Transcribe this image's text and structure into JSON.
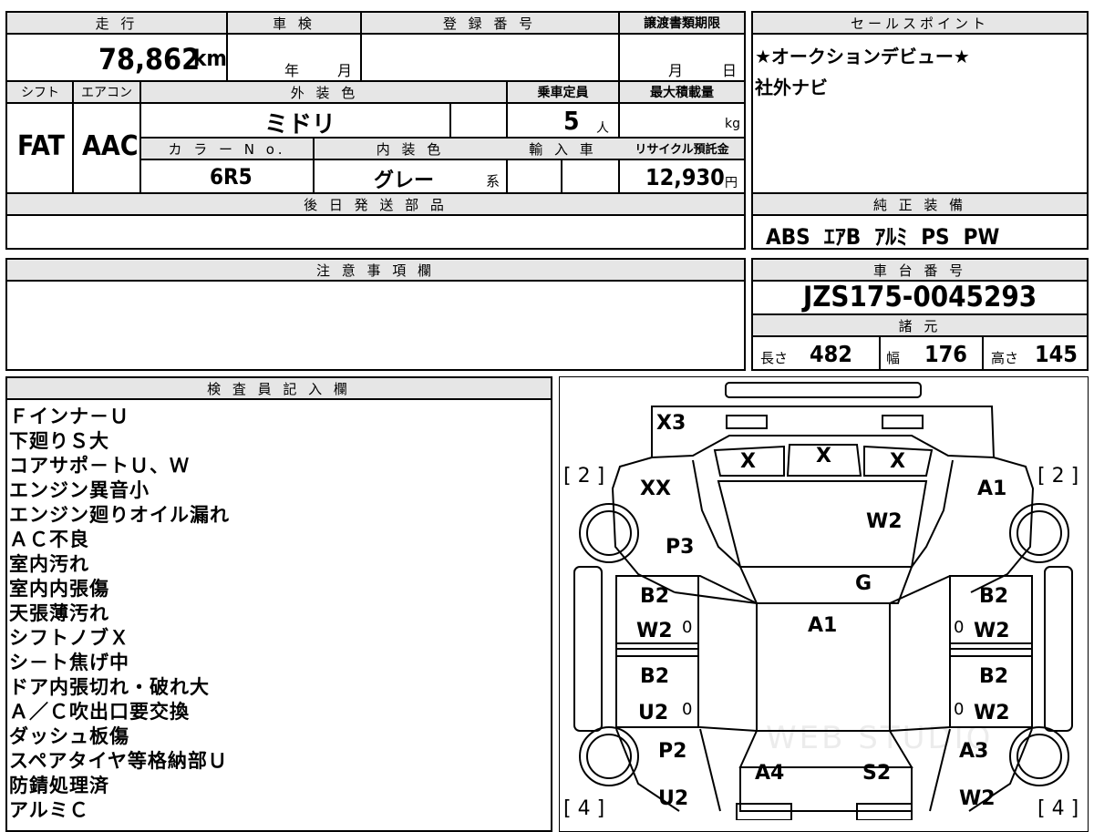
{
  "sheet": {
    "mileage_label": "走 行",
    "mileage_value": "78,862",
    "mileage_unit": "km",
    "inspection_label": "車 検",
    "inspection_year": "年",
    "inspection_month": "月",
    "registration_label": "登 録 番 号",
    "transfer_label": "譲渡書類期限",
    "transfer_month": "月",
    "transfer_day": "日",
    "shift_label": "シフト",
    "shift_value": "FAT",
    "aircon_label": "エアコン",
    "aircon_value": "AAC",
    "exterior_color_label": "外 装 色",
    "exterior_color_value": "ミドリ",
    "capacity_label": "乗車定員",
    "capacity_value": "5",
    "capacity_unit": "人",
    "max_load_label": "最大積載量",
    "max_load_unit": "kg",
    "color_no_label": "カ ラ ー N o.",
    "color_no_value": "6R5",
    "interior_color_label": "内 装 色",
    "interior_color_value": "グレー",
    "interior_color_suffix": "系",
    "import_label": "輸 入 車",
    "recycle_label": "リサイクル預託金",
    "recycle_value": "12,930",
    "recycle_unit": "円",
    "later_parts_label": "後 日 発 送 部 品",
    "notes_label": "注 意 事 項 欄",
    "sales_point_label": "セールスポイント",
    "sales_points": [
      "★オークションデビュー★",
      "社外ナビ"
    ],
    "equipment_label": "純 正 装 備",
    "equipment_value": "ABS  ｴｱB  ｱﾙﾐ  PS  PW",
    "chassis_label": "車 台 番 号",
    "chassis_value": "JZS175-0045293",
    "spec_label": "諸 元",
    "length_label": "長さ",
    "length_value": "482",
    "width_label": "幅",
    "width_value": "176",
    "height_label": "高さ",
    "height_value": "145",
    "inspector_label": "検 査 員 記 入 欄",
    "inspector_remarks": [
      "Ｆインナ－Ｕ",
      "下廻りＳ大",
      "コアサポ－トＵ、Ｗ",
      "エンジン異音小",
      "エンジン廻りオイル漏れ",
      "ＡＣ不良",
      "室内汚れ",
      "室内内張傷",
      "天張薄汚れ",
      "シフトノブＸ",
      "シ－ト焦げ中",
      "ドア内張切れ・破れ大",
      "Ａ／Ｃ吹出口要交換",
      "ダッシュ板傷",
      "スペアタイヤ等格納部Ｕ",
      "防錆処理済",
      "アルミＣ"
    ]
  },
  "diagram": {
    "marks": {
      "x3": "X3",
      "x_left": "X",
      "x_center": "X",
      "x_right": "X",
      "xx": "XX",
      "a1_front_right": "A1",
      "w2_hood": "W2",
      "p3": "P3",
      "g": "G",
      "b2_fl": "B2",
      "w2_fl": "W2",
      "a1_roof": "A1",
      "b2_fr": "B2",
      "w2_fr": "W2",
      "b2_rl": "B2",
      "u2_rl": "U2",
      "b2_rr": "B2",
      "w2_rr": "W2",
      "p2": "P2",
      "a3": "A3",
      "a4": "A4",
      "s2": "S2",
      "u2_rear": "U2",
      "w2_rear": "W2",
      "zero1": "0",
      "zero2": "0",
      "zero3": "0",
      "zero4": "0"
    },
    "tire_marks": {
      "fl": "[ 2 ]",
      "fr": "[ 2 ]",
      "rl": "[ 4 ]",
      "rr": "[ 4 ]"
    },
    "watermark": "WEB STUDIO"
  }
}
